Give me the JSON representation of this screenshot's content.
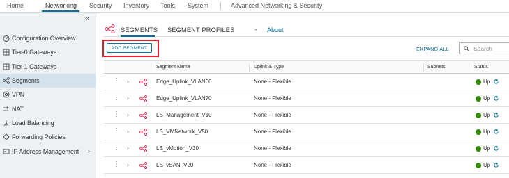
{
  "topnav": {
    "items": [
      "Home",
      "Networking",
      "Security",
      "Inventory",
      "Tools",
      "System",
      "Advanced Networking & Security"
    ],
    "active": "Networking"
  },
  "sidebar": {
    "collapse_glyph": "«",
    "items": [
      {
        "label": "Configuration Overview",
        "icon": "dashboard-icon"
      },
      {
        "label": "Tier-0 Gateways",
        "icon": "tier0-gateway-icon"
      },
      {
        "label": "Tier-1 Gateways",
        "icon": "tier1-gateway-icon"
      },
      {
        "label": "Segments",
        "icon": "segments-icon",
        "active": true
      },
      {
        "label": "VPN",
        "icon": "vpn-icon"
      },
      {
        "label": "NAT",
        "icon": "nat-icon"
      },
      {
        "label": "Load Balancing",
        "icon": "load-balancing-icon"
      },
      {
        "label": "Forwarding Policies",
        "icon": "forwarding-policies-icon"
      },
      {
        "label": "IP Address Management",
        "icon": "ip-address-management-icon",
        "chevron": "›"
      }
    ]
  },
  "main": {
    "tabs": [
      {
        "label": "SEGMENTS",
        "active": true
      },
      {
        "label": "SEGMENT PROFILES"
      }
    ],
    "about_label": "About",
    "add_button_label": "ADD SEGMENT",
    "expand_all_label": "EXPAND ALL",
    "search": {
      "placeholder": "Search",
      "value": ""
    }
  },
  "table": {
    "columns": [
      "Segment Name",
      "Uplink & Type",
      "Subnets",
      "Status"
    ],
    "rows": [
      {
        "name": "Edge_Uplink_VLAN60",
        "uplink": "None - Flexible",
        "subnets": "",
        "status": "Up"
      },
      {
        "name": "Edge_Uplink_VLAN70",
        "uplink": "None - Flexible",
        "subnets": "",
        "status": "Up"
      },
      {
        "name": "LS_Management_V10",
        "uplink": "None - Flexible",
        "subnets": "",
        "status": "Up"
      },
      {
        "name": "LS_VMNetwork_V50",
        "uplink": "None - Flexible",
        "subnets": "",
        "status": "Up"
      },
      {
        "name": "LS_vMotion_V30",
        "uplink": "None - Flexible",
        "subnets": "",
        "status": "Up"
      },
      {
        "name": "LS_vSAN_V20",
        "uplink": "None - Flexible",
        "subnets": "",
        "status": "Up"
      }
    ]
  },
  "colors": {
    "accent": "#0072a3",
    "highlight_box": "#e11e2a",
    "segment_icon": "#e8365d",
    "status_up": "#318700",
    "sidebar_bg": "#eef1f3",
    "sidebar_active_bg": "#d3e2ec"
  }
}
